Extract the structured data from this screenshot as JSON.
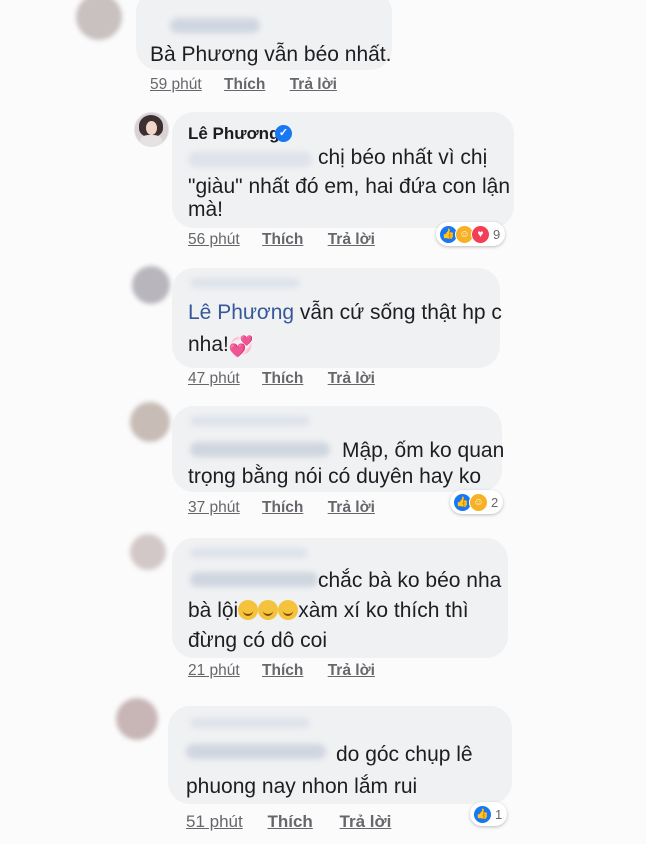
{
  "comments": [
    {
      "text": "Bà Phương vẫn béo nhất.",
      "time": "59 phút",
      "like": "Thích",
      "reply": "Trả lời"
    },
    {
      "author": "Lê Phương",
      "text_line1": "chị béo nhất vì chị",
      "text_line2": "\"giàu\" nhất đó em, hai đứa con lận",
      "text_line3": "mà!",
      "time": "56 phút",
      "like": "Thích",
      "reply": "Trả lời",
      "reaction_count": "9"
    },
    {
      "mention": "Lê Phương",
      "text_line1": " vẫn cứ sống thật hp c",
      "text_line2": "nha!",
      "time": "47 phút",
      "like": "Thích",
      "reply": "Trả lời"
    },
    {
      "text_line1": "Mập, ốm ko quan",
      "text_line2": "trọng bằng nói có duyên hay ko",
      "time": "37 phút",
      "like": "Thích",
      "reply": "Trả lời",
      "reaction_count": "2"
    },
    {
      "text_line1": "chắc bà ko béo nha",
      "text_line2a": "bà lội",
      "text_line2b": "xàm xí ko thích thì",
      "text_line3": "đừng có dô coi",
      "time": "21 phút",
      "like": "Thích",
      "reply": "Trả lời"
    },
    {
      "text_line1": "do góc chụp lê",
      "text_line2": "phuong nay nhon lắm rui",
      "time": "51 phút",
      "like": "Thích",
      "reply": "Trả lời",
      "reaction_count": "1"
    }
  ],
  "icons": {
    "like": "like-icon",
    "care": "care-icon",
    "love": "love-icon",
    "verified": "verified-badge-icon",
    "laughing": "rolling-laughing-emoji",
    "hearts": "two-hearts-emoji"
  },
  "colors": {
    "accent": "#1877f2",
    "mention": "#365899",
    "bubble": "#f0f1f3",
    "meta": "#65676b"
  }
}
